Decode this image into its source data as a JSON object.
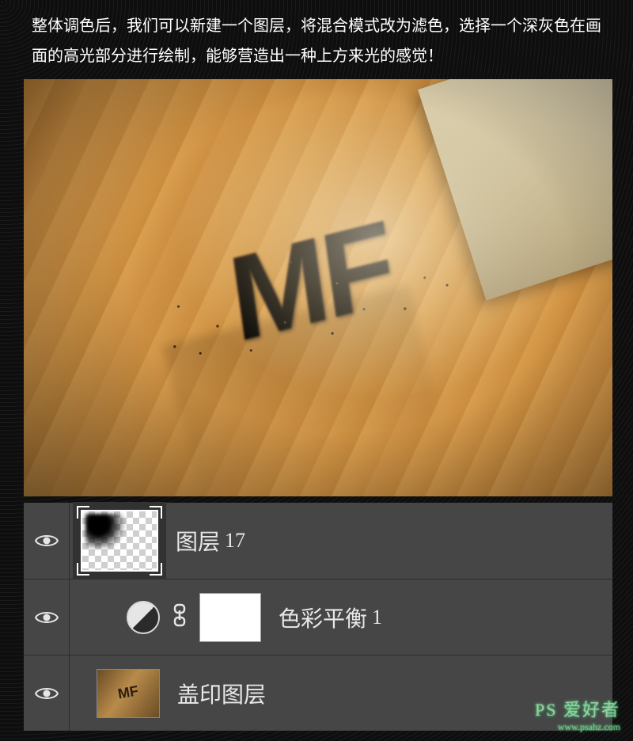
{
  "caption": "整体调色后，我们可以新建一个图层，将混合模式改为滤色，选择一个深灰色在画面的高光部分进行绘制，能够营造出一种上方来光的感觉！",
  "artwork_text": "MF",
  "layers_panel": {
    "rows": [
      {
        "visible": true,
        "selected": true,
        "kind": "pixel",
        "thumb": "alpha-smudge",
        "name": "图层",
        "suffix": "17"
      },
      {
        "visible": true,
        "selected": false,
        "kind": "adjustment",
        "adjustment_icon": "color-balance",
        "linked": true,
        "mask": "white",
        "name": "色彩平衡",
        "suffix": "1"
      },
      {
        "visible": true,
        "selected": false,
        "kind": "pixel",
        "thumb": "stamp",
        "name": "盖印图层",
        "suffix": ""
      }
    ]
  },
  "watermark": {
    "main": "PS 爱好者",
    "url": "www.psahz.com"
  }
}
